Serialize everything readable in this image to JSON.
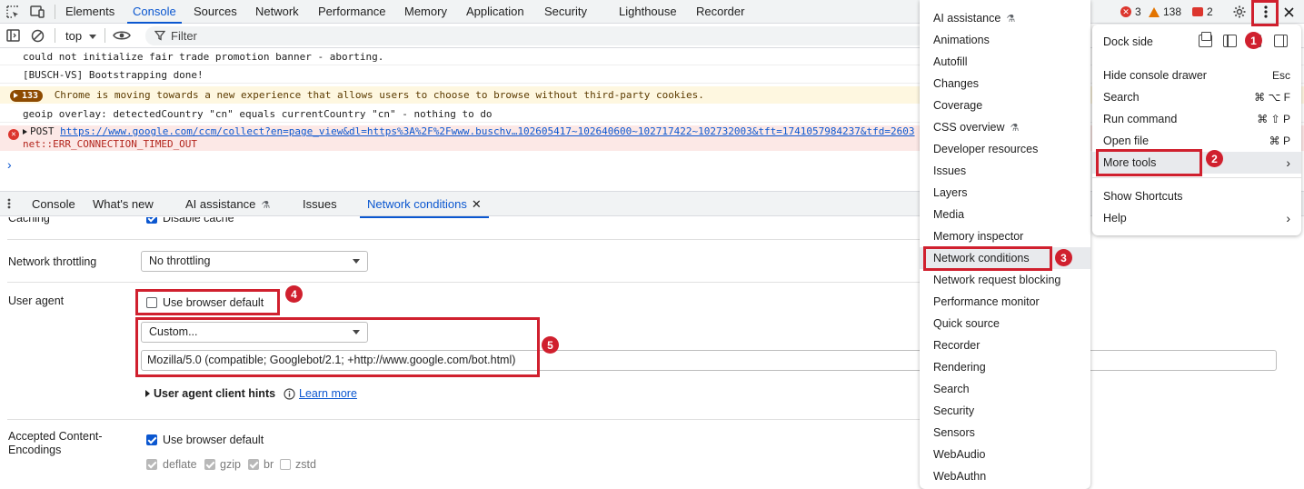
{
  "top_tabs": [
    "Elements",
    "Console",
    "Sources",
    "Network",
    "Performance",
    "Memory",
    "Application",
    "Security",
    "Lighthouse",
    "Recorder"
  ],
  "status": {
    "errors": "3",
    "warnings": "138",
    "issues": "2"
  },
  "toolbar": {
    "context": "top",
    "filter_placeholder": "Filter"
  },
  "console": {
    "msg1": "could not initialize fair trade promotion banner - aborting.",
    "msg2": "[BUSCH-VS] Bootstrapping done!",
    "warn_count": "133",
    "warn_text": "Chrome is moving towards a new experience that allows users to choose to browse without third-party cookies.",
    "msg4": "geoip overlay: detectedCountry \"cn\" equals currentCountry \"cn\" - nothing to do",
    "err_method": "POST",
    "err_url": "https://www.google.com/ccm/collect?en=page_view&dl=https%3A%2F%2Fwww.buschv…102605417~102640600~102717422~102732003&tft=1741057984237&tfd=2603",
    "err_text": "net::ERR_CONNECTION_TIMED_OUT",
    "prompt": "›"
  },
  "drawer_tabs": [
    "Console",
    "What's new",
    "AI assistance",
    "Issues",
    "Network conditions"
  ],
  "network_conditions": {
    "caching_label": "Caching",
    "disable_cache": "Disable cache",
    "throttling_label": "Network throttling",
    "throttling_value": "No throttling",
    "ua_label": "User agent",
    "use_browser_default": "Use browser default",
    "ua_select": "Custom...",
    "ua_string": "Mozilla/5.0 (compatible; Googlebot/2.1; +http://www.google.com/bot.html)",
    "ua_client_hints": "User agent client hints",
    "learn_more": "Learn more",
    "encodings_label_1": "Accepted Content-",
    "encodings_label_2": "Encodings",
    "encodings_default": "Use browser default",
    "encodings": [
      "deflate",
      "gzip",
      "br",
      "zstd"
    ]
  },
  "more_tools": [
    "AI assistance",
    "Animations",
    "Autofill",
    "Changes",
    "Coverage",
    "CSS overview",
    "Developer resources",
    "Issues",
    "Layers",
    "Media",
    "Memory inspector",
    "Network conditions",
    "Network request blocking",
    "Performance monitor",
    "Quick source",
    "Recorder",
    "Rendering",
    "Search",
    "Security",
    "Sensors",
    "WebAudio",
    "WebAuthn"
  ],
  "main_menu": {
    "dock_side": "Dock side",
    "hide_drawer": "Hide console drawer",
    "hide_drawer_key": "Esc",
    "search": "Search",
    "search_key": "⌘ ⌥ F",
    "run_command": "Run command",
    "run_command_key": "⌘ ⇧ P",
    "open_file": "Open file",
    "open_file_key": "⌘ P",
    "more_tools": "More tools",
    "show_shortcuts": "Show Shortcuts",
    "help": "Help"
  },
  "annotations": [
    "1",
    "2",
    "3",
    "4",
    "5"
  ],
  "colors": {
    "accent": "#0b57d0",
    "annotation": "#d0202e",
    "warning_bg": "#fef7e0",
    "error_bg": "#fce8e6"
  }
}
